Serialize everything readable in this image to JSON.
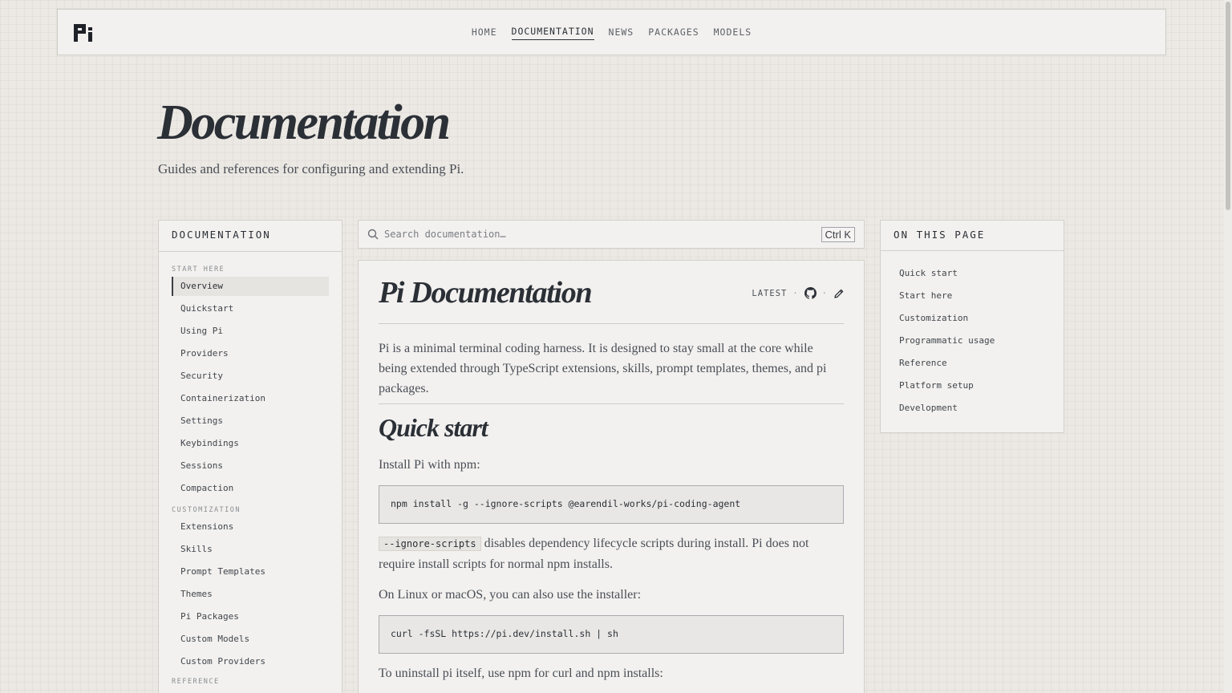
{
  "header": {
    "logo": "Pi",
    "nav": [
      {
        "label": "HOME",
        "active": false
      },
      {
        "label": "DOCUMENTATION",
        "active": true
      },
      {
        "label": "NEWS",
        "active": false
      },
      {
        "label": "PACKAGES",
        "active": false
      },
      {
        "label": "MODELS",
        "active": false
      }
    ]
  },
  "hero": {
    "title": "Documentation",
    "subtitle": "Guides and references for configuring and extending Pi."
  },
  "sidebar": {
    "title": "DOCUMENTATION",
    "sections": [
      {
        "label": "START HERE",
        "items": [
          "Overview",
          "Quickstart",
          "Using Pi",
          "Providers",
          "Security",
          "Containerization",
          "Settings",
          "Keybindings",
          "Sessions",
          "Compaction"
        ]
      },
      {
        "label": "CUSTOMIZATION",
        "items": [
          "Extensions",
          "Skills",
          "Prompt Templates",
          "Themes",
          "Pi Packages",
          "Custom Models",
          "Custom Providers"
        ]
      },
      {
        "label": "REFERENCE",
        "items": []
      }
    ],
    "active_item": "Overview"
  },
  "search": {
    "placeholder": "Search documentation…",
    "shortcut": "Ctrl K"
  },
  "article": {
    "title": "Pi Documentation",
    "version_label": "LATEST",
    "intro": "Pi is a minimal terminal coding harness. It is designed to stay small at the core while being extended through TypeScript extensions, skills, prompt templates, themes, and pi packages.",
    "quickstart_heading": "Quick start",
    "install_text": "Install Pi with npm:",
    "install_cmd": "npm install -g --ignore-scripts @earendil-works/pi-coding-agent",
    "ignore_code": "--ignore-scripts",
    "ignore_text": "disables dependency lifecycle scripts during install. Pi does not require install scripts for normal npm installs.",
    "linux_text": "On Linux or macOS, you can also use the installer:",
    "curl_cmd": "curl -fsSL https://pi.dev/install.sh | sh",
    "uninstall_text": "To uninstall pi itself, use npm for curl and npm installs:"
  },
  "toc": {
    "title": "ON THIS PAGE",
    "items": [
      "Quick start",
      "Start here",
      "Customization",
      "Programmatic usage",
      "Reference",
      "Platform setup",
      "Development"
    ]
  }
}
